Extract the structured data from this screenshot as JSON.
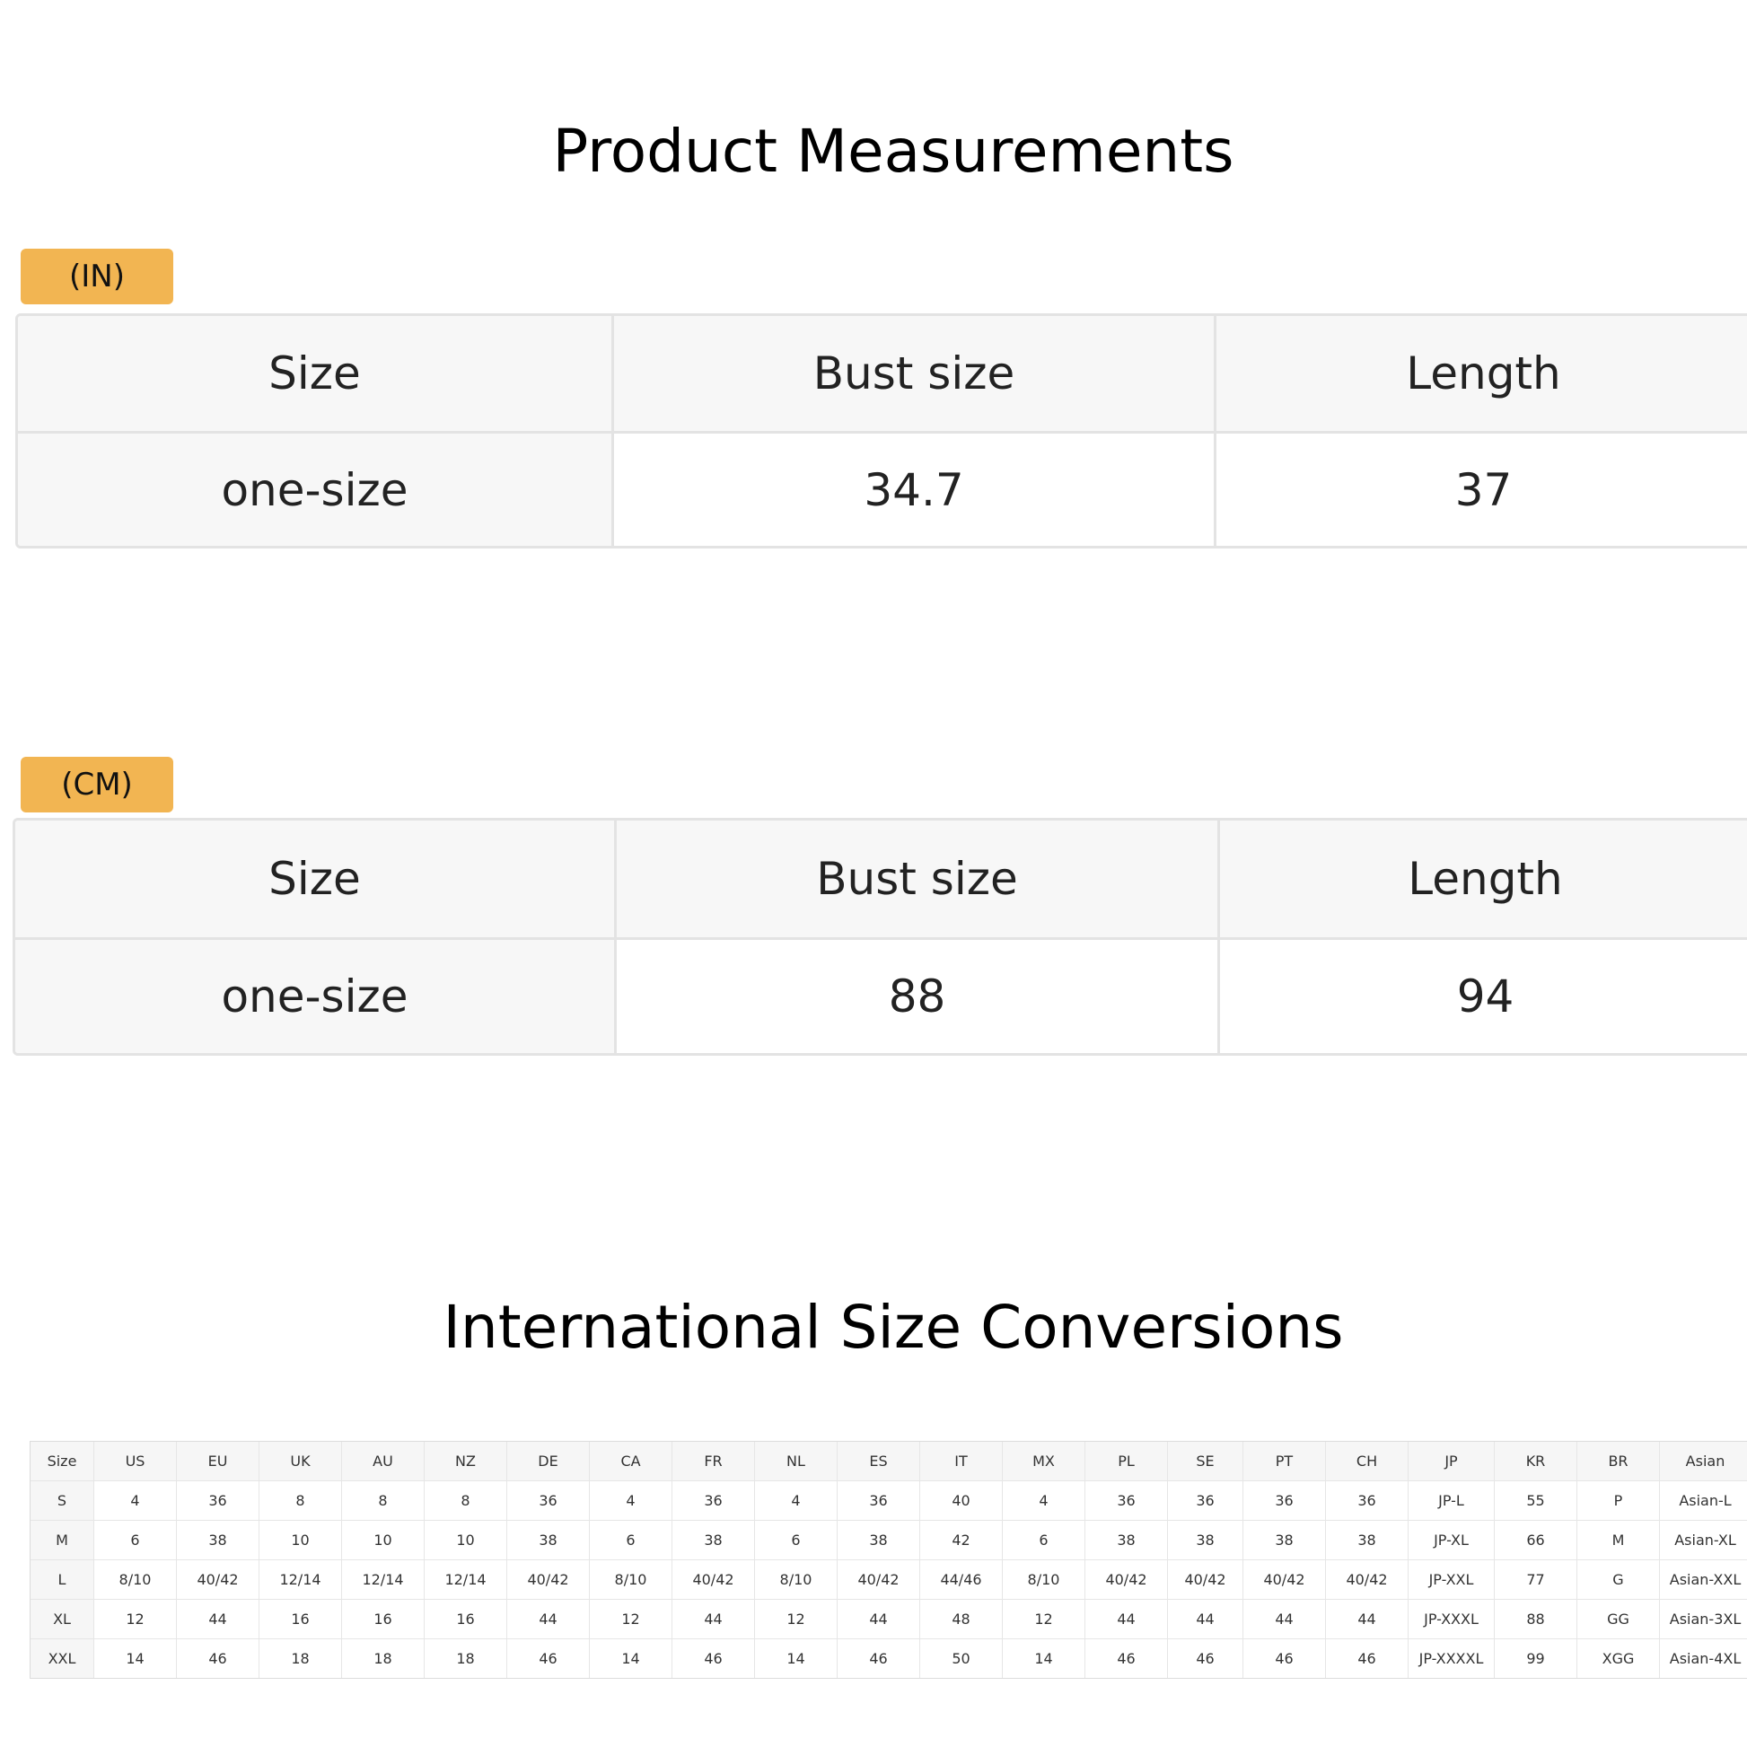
{
  "title_main": "Product Measurements",
  "inch_table": {
    "badge": "(IN)",
    "headers": [
      "Size",
      "Bust size",
      "Length"
    ],
    "row": [
      "one-size",
      "34.7",
      "37"
    ]
  },
  "cm_table": {
    "badge": "(CM)",
    "headers": [
      "Size",
      "Bust size",
      "Length"
    ],
    "row": [
      "one-size",
      "88",
      "94"
    ]
  },
  "title_intl": "International Size Conversions",
  "intl_table": {
    "headers": [
      "Size",
      "US",
      "EU",
      "UK",
      "AU",
      "NZ",
      "DE",
      "CA",
      "FR",
      "NL",
      "ES",
      "IT",
      "MX",
      "PL",
      "SE",
      "PT",
      "CH",
      "JP",
      "KR",
      "BR",
      "Asian"
    ],
    "rows": [
      [
        "S",
        "4",
        "36",
        "8",
        "8",
        "8",
        "36",
        "4",
        "36",
        "4",
        "36",
        "40",
        "4",
        "36",
        "36",
        "36",
        "36",
        "JP-L",
        "55",
        "P",
        "Asian-L"
      ],
      [
        "M",
        "6",
        "38",
        "10",
        "10",
        "10",
        "38",
        "6",
        "38",
        "6",
        "38",
        "42",
        "6",
        "38",
        "38",
        "38",
        "38",
        "JP-XL",
        "66",
        "M",
        "Asian-XL"
      ],
      [
        "L",
        "8/10",
        "40/42",
        "12/14",
        "12/14",
        "12/14",
        "40/42",
        "8/10",
        "40/42",
        "8/10",
        "40/42",
        "44/46",
        "8/10",
        "40/42",
        "40/42",
        "40/42",
        "40/42",
        "JP-XXL",
        "77",
        "G",
        "Asian-XXL"
      ],
      [
        "XL",
        "12",
        "44",
        "16",
        "16",
        "16",
        "44",
        "12",
        "44",
        "12",
        "44",
        "48",
        "12",
        "44",
        "44",
        "44",
        "44",
        "JP-XXXL",
        "88",
        "GG",
        "Asian-3XL"
      ],
      [
        "XXL",
        "14",
        "46",
        "18",
        "18",
        "18",
        "46",
        "14",
        "46",
        "14",
        "46",
        "50",
        "14",
        "46",
        "46",
        "46",
        "46",
        "JP-XXXXL",
        "99",
        "XGG",
        "Asian-4XL"
      ]
    ]
  },
  "colors": {
    "badge": "#f2b552",
    "header_bg": "#f7f7f7",
    "border": "#e3e3e3"
  }
}
